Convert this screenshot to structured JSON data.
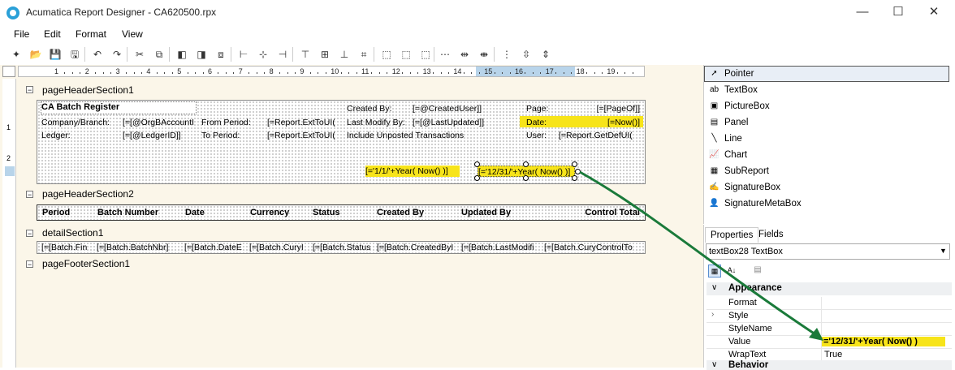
{
  "window": {
    "title": "Acumatica Report Designer - CA620500.rpx",
    "minimize": "—",
    "maximize": "☐",
    "close": "✕"
  },
  "menu": [
    "File",
    "Edit",
    "Format",
    "View"
  ],
  "ruler": {
    "numbers": [
      "1",
      "2",
      "3",
      "4",
      "5",
      "6",
      "7",
      "8",
      "9",
      "10",
      "11",
      "12",
      "13",
      "14",
      "15",
      "16",
      "17",
      "18",
      "19"
    ]
  },
  "vruler": [
    "1",
    "2"
  ],
  "sections": {
    "pageHeader1": "pageHeaderSection1",
    "pageHeader2": "pageHeaderSection2",
    "detail": "detailSection1",
    "pageFooter": "pageFooterSection1"
  },
  "header1": {
    "title": "CA Batch Register",
    "created_by_label": "Created By:",
    "created_by_val": "[=@CreatedUser]]",
    "page_label": "Page:",
    "page_val": "[=[PageOf]]",
    "company_label": "Company/Branch:",
    "company_val": "[=[@OrgBAccountI",
    "from_period_label": "From Period:",
    "from_period_val": "[=Report.ExtToUI(",
    "last_modify_label": "Last Modify By:",
    "last_modify_val": "[=[@LastUpdated]]",
    "date_label": "Date:",
    "date_val": "[=Now()]",
    "ledger_label": "Ledger:",
    "ledger_val": "[=[@LedgerID]]",
    "to_period_label": "To Period:",
    "to_period_val": "[=Report.ExtToUI(",
    "include_unposted": "Include Unposted Transactions",
    "user_label": "User:",
    "user_val": "[=Report.GetDefUI(",
    "start_date": "[='1/1/'+Year( Now() )]",
    "end_date": "[='12/31/'+Year( Now() )]"
  },
  "columns": [
    "Period",
    "Batch Number",
    "Date",
    "Currency",
    "Status",
    "Created By",
    "Updated By",
    "Control Total"
  ],
  "detail_fields": [
    "[=[Batch.Fin",
    "[=[Batch.BatchNbr]",
    "[=[Batch.DateE",
    "[=[Batch.CuryI",
    "[=[Batch.Status",
    "[=[Batch.CreatedByI",
    "[=[Batch.LastModifi",
    "[=[Batch.CuryControlTo"
  ],
  "toolbox": {
    "items": [
      {
        "label": "Pointer",
        "icon": "pointer-icon",
        "glyph": "➚"
      },
      {
        "label": "TextBox",
        "icon": "textbox-icon",
        "glyph": "ab"
      },
      {
        "label": "PictureBox",
        "icon": "picturebox-icon",
        "glyph": "▣"
      },
      {
        "label": "Panel",
        "icon": "panel-icon",
        "glyph": "▤"
      },
      {
        "label": "Line",
        "icon": "line-icon",
        "glyph": "╲"
      },
      {
        "label": "Chart",
        "icon": "chart-icon",
        "glyph": "📈"
      },
      {
        "label": "SubReport",
        "icon": "subreport-icon",
        "glyph": "▦"
      },
      {
        "label": "SignatureBox",
        "icon": "signaturebox-icon",
        "glyph": "✍"
      },
      {
        "label": "SignatureMetaBox",
        "icon": "signaturemetabox-icon",
        "glyph": "👤"
      }
    ]
  },
  "properties": {
    "tabs": [
      "Properties",
      "Fields"
    ],
    "object": "textBox28  TextBox",
    "category": "Appearance",
    "rows": [
      {
        "name": "Format",
        "value": ""
      },
      {
        "name": "Style",
        "value": ""
      },
      {
        "name": "StyleName",
        "value": ""
      },
      {
        "name": "Value",
        "value": "='12/31/'+Year( Now() )"
      },
      {
        "name": "WrapText",
        "value": "True"
      }
    ],
    "next_category": "Behavior"
  },
  "colors": {
    "highlight": "#f7e41a",
    "arrow": "#1a7a3a",
    "selected_tool_bg": "#e8eef6"
  }
}
